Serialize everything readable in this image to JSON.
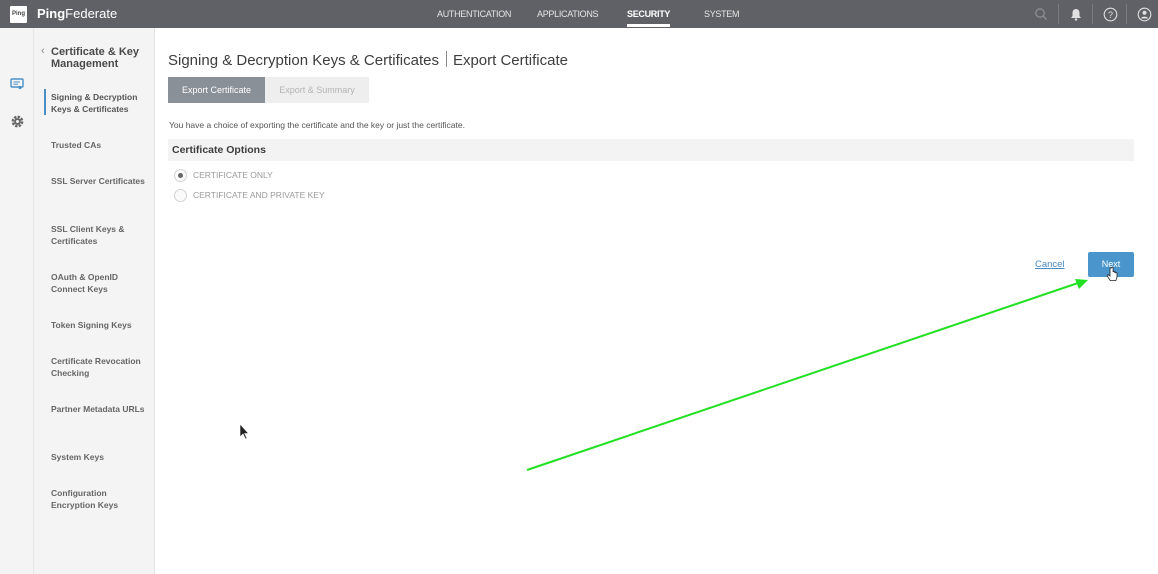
{
  "app": {
    "logo": "Ping",
    "brand_bold": "Ping",
    "brand_rest": "Federate"
  },
  "topnav": {
    "items": [
      {
        "label": "AUTHENTICATION"
      },
      {
        "label": "APPLICATIONS"
      },
      {
        "label": "SECURITY"
      },
      {
        "label": "SYSTEM"
      }
    ],
    "active": "SECURITY",
    "icons": [
      "search-icon",
      "bell-icon",
      "help-icon",
      "user-icon"
    ]
  },
  "rail": {
    "icons": [
      "certificate-icon",
      "gear-icon"
    ]
  },
  "sidebar": {
    "back_glyph": "‹",
    "title": "Certificate & Key Management",
    "items": [
      {
        "label": "Signing & Decryption Keys & Certificates"
      },
      {
        "label": "Trusted CAs"
      },
      {
        "label": "SSL Server Certificates"
      },
      {
        "label": "SSL Client Keys & Certificates"
      },
      {
        "label": "OAuth & OpenID Connect Keys"
      },
      {
        "label": "Token Signing Keys"
      },
      {
        "label": "Certificate Revocation Checking"
      },
      {
        "label": "Partner Metadata URLs"
      },
      {
        "label": "System Keys"
      },
      {
        "label": "Configuration Encryption Keys"
      }
    ],
    "active_item": "Signing & Decryption Keys & Certificates"
  },
  "main": {
    "title_left": "Signing & Decryption Keys & Certificates",
    "title_right": "Export Certificate",
    "tabs": [
      {
        "label": "Export Certificate",
        "active": true
      },
      {
        "label": "Export & Summary",
        "active": false
      }
    ],
    "description": "You have a choice of exporting the certificate and the key or just the certificate.",
    "section_title": "Certificate Options",
    "options": [
      {
        "label": "CERTIFICATE ONLY",
        "checked": true
      },
      {
        "label": "CERTIFICATE AND PRIVATE KEY",
        "checked": false
      }
    ],
    "cancel_label": "Cancel",
    "next_label": "Next"
  },
  "colors": {
    "topbar": "#5f6166",
    "accent": "#4a96cc",
    "annotation_arrow": "#22e022"
  }
}
